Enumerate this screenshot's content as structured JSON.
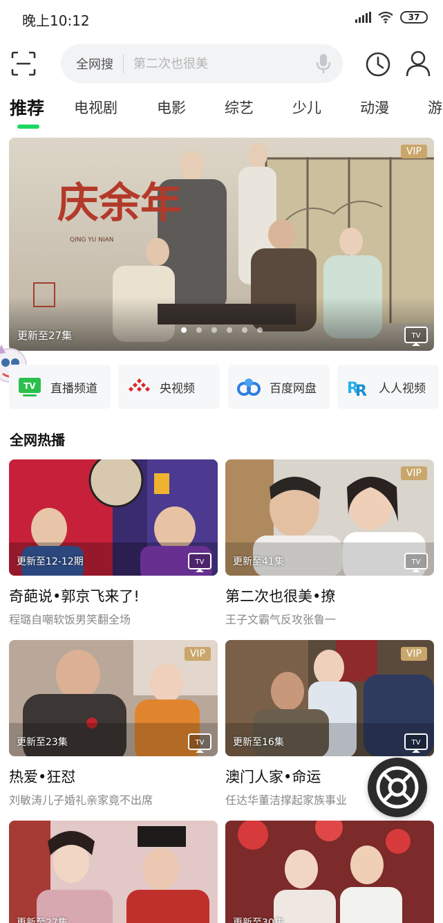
{
  "status": {
    "time": "晚上10:12",
    "battery": "37"
  },
  "search": {
    "scope": "全网搜",
    "placeholder": "第二次也很美"
  },
  "tabs": [
    {
      "label": "推荐"
    },
    {
      "label": "电视剧"
    },
    {
      "label": "电影"
    },
    {
      "label": "综艺"
    },
    {
      "label": "少儿"
    },
    {
      "label": "动漫"
    },
    {
      "label": "游"
    }
  ],
  "banner": {
    "badge": "VIP",
    "caption": "更新至27集",
    "poster_title": "庆余年",
    "poster_sub": "QING YU NIAN",
    "slide_count": 6,
    "active_slide": 1
  },
  "shortcuts": [
    {
      "label": "直播频道",
      "icon": "tv-live-icon"
    },
    {
      "label": "央视频",
      "icon": "cctv-video-icon"
    },
    {
      "label": "百度网盘",
      "icon": "baidu-netdisk-icon"
    },
    {
      "label": "人人视频",
      "icon": "rr-video-icon"
    }
  ],
  "section": {
    "title": "全网热播"
  },
  "cards": [
    {
      "update": "更新至12-12期",
      "title": "奇葩说•郭京飞来了!",
      "sub": "程璐自嘲软饭男笑翻全场",
      "vip": ""
    },
    {
      "update": "更新至41集",
      "title": "第二次也很美•撩",
      "sub": "王子文霸气反攻张鲁一",
      "vip": "VIP"
    },
    {
      "update": "更新至23集",
      "title": "热爱•狂怼",
      "sub": "刘敏涛儿子婚礼亲家竟不出席",
      "vip": "VIP"
    },
    {
      "update": "更新至16集",
      "title": "澳门人家•命运",
      "sub": "任达华董洁撑起家族事业",
      "vip": "VIP"
    },
    {
      "update": "更新至27集",
      "title": "",
      "sub": "",
      "vip": ""
    },
    {
      "update": "更新至30集",
      "title": "",
      "sub": "",
      "vip": ""
    }
  ],
  "colors": {
    "accent": "#1ed760",
    "vip": "#c9a66b"
  }
}
